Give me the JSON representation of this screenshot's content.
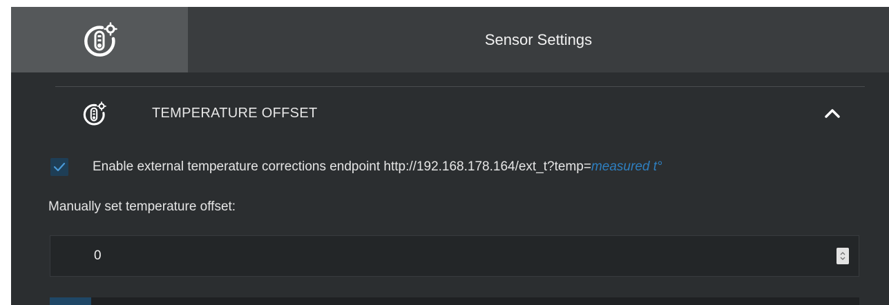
{
  "header": {
    "title": "Sensor Settings",
    "icon": "thermometer-gear-icon"
  },
  "section": {
    "title": "TEMPERATURE OFFSET",
    "icon": "thermometer-gear-icon",
    "collapse_icon": "chevron-up-icon",
    "expanded": true
  },
  "external_corrections": {
    "checked": true,
    "label": "Enable external temperature corrections endpoint http://192.168.178.164/ext_t?temp=",
    "link_text": "measured t°"
  },
  "manual_offset": {
    "label": "Manually set temperature offset:",
    "value": "0"
  },
  "colors": {
    "accent": "#2e7fc0",
    "checkbox_fill": "#1e3e56",
    "header_bg": "#3a3d3f",
    "icon_cell_bg": "#55585a",
    "panel_bg": "#2b2e30"
  }
}
